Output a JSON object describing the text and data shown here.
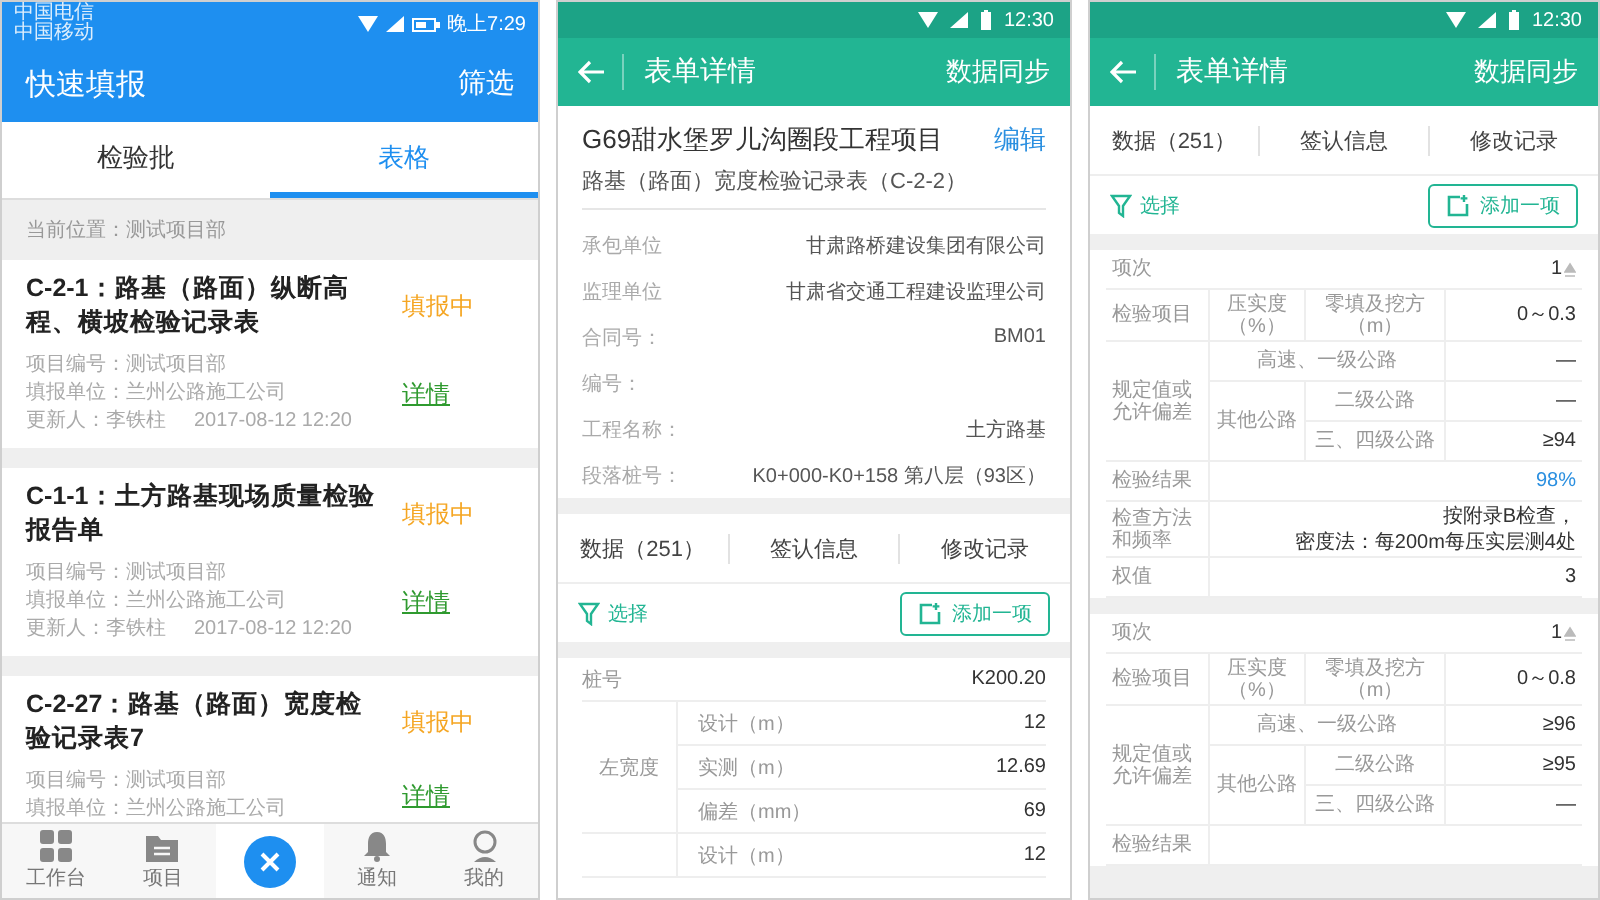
{
  "quick_report_screen": {
    "status_bar": {
      "carriers": [
        "中国电信",
        "中国移动"
      ],
      "time": "晚上7:29"
    },
    "header": {
      "title": "快速填报",
      "action": "筛选"
    },
    "tabs": [
      {
        "label": "检验批",
        "selected": false
      },
      {
        "label": "表格",
        "selected": true
      }
    ],
    "location": "当前位置：测试项目部",
    "records": [
      {
        "title": "C-2-1：路基（路面）纵断高程、横坡检验记录表",
        "status": "填报中",
        "details": [
          "项目编号：测试项目部",
          "填报单位：兰州公路施工公司"
        ],
        "updated_by": "更新人：李铁柱",
        "updated_at": "2017-08-12  12:20",
        "link": "详情"
      },
      {
        "title": "C-1-1：土方路基现场质量检验报告单",
        "status": "填报中",
        "details": [
          "项目编号：测试项目部",
          "填报单位：兰州公路施工公司"
        ],
        "updated_by": "更新人：李铁柱",
        "updated_at": "2017-08-12  12:20",
        "link": "详情"
      },
      {
        "title": "C-2-27：路基（路面）宽度检验记录表7",
        "status": "填报中",
        "details": [
          "项目编号：测试项目部",
          "填报单位：兰州公路施工公司"
        ],
        "link": "详情"
      }
    ],
    "bottom_nav": [
      {
        "kind": "tab",
        "label": "工作台"
      },
      {
        "kind": "tab",
        "label": "项目"
      },
      {
        "kind": "action"
      },
      {
        "kind": "tab",
        "label": "通知"
      },
      {
        "kind": "tab",
        "label": "我的"
      }
    ]
  },
  "form_detail_screen": {
    "status_bar": {
      "time": "12:30"
    },
    "header": {
      "title": "表单详情",
      "action": "数据同步"
    },
    "project": {
      "name": "G69甜水堡罗儿沟圈段工程项目",
      "edit": "编辑",
      "form": "路基（路面）宽度检验记录表（C-2-2）"
    },
    "fields": [
      {
        "label": "承包单位",
        "value": "甘肃路桥建设集团有限公司"
      },
      {
        "label": "监理单位",
        "value": "甘肃省交通工程建设监理公司"
      },
      {
        "label": "合同号：",
        "value": "BM01"
      },
      {
        "label": "编号："
      },
      {
        "label": "工程名称：",
        "value": "土方路基"
      },
      {
        "label": "段落桩号：",
        "value": "K0+000-K0+158 第八层（93区）"
      }
    ],
    "sections": [
      "数据（251）",
      "签认信息",
      "修改记录"
    ],
    "filter": "选择",
    "add": "添加一项",
    "measurements": {
      "station": {
        "label": "桩号",
        "value": "K200.20"
      },
      "groups": [
        {
          "label": "左宽度",
          "rows": [
            {
              "label": "设计（m）",
              "value": "12"
            },
            {
              "label": "实测（m）",
              "value": "12.69"
            },
            {
              "label": "偏差（mm）",
              "value": "69"
            }
          ]
        },
        {
          "rows": [
            {
              "label": "设计（m）",
              "value": "12"
            }
          ]
        }
      ]
    }
  },
  "form_data_screen": {
    "status_bar": {
      "time": "12:30"
    },
    "header": {
      "title": "表单详情",
      "action": "数据同步"
    },
    "sections": [
      "数据（251）",
      "签认信息",
      "修改记录"
    ],
    "filter": "选择",
    "add": "添加一项",
    "blocks": [
      {
        "item_no": {
          "label": "项次",
          "value": "1"
        },
        "inspect": {
          "label": "检验项目",
          "col_a": "压实度（%）",
          "col_b": "零填及挖方（m）",
          "value": "0～0.3"
        },
        "spec": {
          "label": "规定值或允许偏差",
          "top": {
            "label": "高速、一级公路",
            "value": "—"
          },
          "other_label": "其他公路",
          "rows": [
            {
              "label": "二级公路",
              "value": "—"
            },
            {
              "label": "三、四级公路",
              "value": "≥94"
            }
          ]
        },
        "result": {
          "label": "检验结果",
          "value": "98%"
        },
        "method": {
          "label": "检查方法和频率",
          "lines": [
            "按附录B检查，",
            "密度法：每200m每压实层测4处"
          ]
        },
        "weight": {
          "label": "权值",
          "value": "3"
        }
      },
      {
        "item_no": {
          "label": "项次",
          "value": "1"
        },
        "inspect": {
          "label": "检验项目",
          "col_a": "压实度（%）",
          "col_b": "零填及挖方（m）",
          "value": "0～0.8"
        },
        "spec": {
          "label": "规定值或允许偏差",
          "top": {
            "label": "高速、一级公路",
            "value": "≥96"
          },
          "other_label": "其他公路",
          "rows": [
            {
              "label": "二级公路",
              "value": "≥95"
            },
            {
              "label": "三、四级公路",
              "value": "—"
            }
          ]
        },
        "result": {
          "label": "检验结果"
        }
      }
    ]
  }
}
